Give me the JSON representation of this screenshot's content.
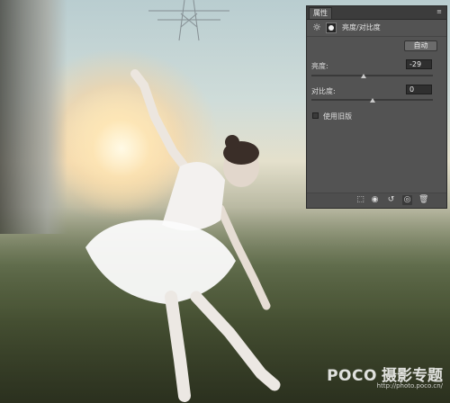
{
  "panel": {
    "tab_label": "属性",
    "adjustment_title": "亮度/对比度",
    "auto_button": "自动",
    "brightness": {
      "label": "亮度:",
      "value": "-29",
      "slider_fraction": 0.43
    },
    "contrast": {
      "label": "对比度:",
      "value": "0",
      "slider_fraction": 0.5
    },
    "use_legacy": {
      "label": "使用旧版",
      "checked": false
    },
    "bottom_icons": [
      "clip-to-layer-icon",
      "view-previous-state-icon",
      "reset-icon",
      "toggle-visibility-icon",
      "delete-icon"
    ]
  },
  "watermark": {
    "brand": "POCO",
    "site_name": "摄影专题",
    "url": "http://photo.poco.cn/"
  }
}
